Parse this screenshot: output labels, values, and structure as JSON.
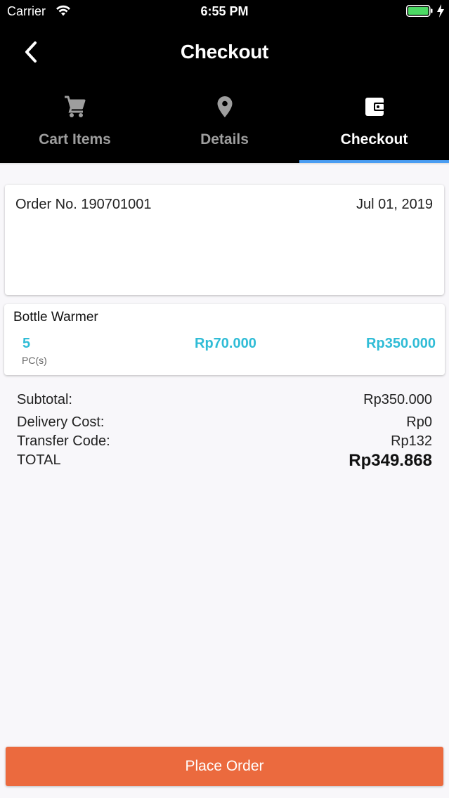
{
  "status_bar": {
    "carrier": "Carrier",
    "time": "6:55 PM",
    "wifi_icon": "wifi-icon",
    "battery_icon": "battery-full-icon",
    "charging_icon": "bolt-icon",
    "battery_color": "#4cd964"
  },
  "nav": {
    "title": "Checkout",
    "back_icon": "chevron-left-icon"
  },
  "tabs": [
    {
      "label": "Cart Items",
      "icon": "cart-icon",
      "active": false
    },
    {
      "label": "Details",
      "icon": "location-pin-icon",
      "active": false
    },
    {
      "label": "Checkout",
      "icon": "wallet-icon",
      "active": true
    }
  ],
  "order": {
    "number": "Order No. 190701001",
    "date": "Jul 01, 2019"
  },
  "items": [
    {
      "name": "Bottle Warmer",
      "quantity": "5",
      "unit": "PC(s)",
      "unit_price": "Rp70.000",
      "line_total": "Rp350.000"
    }
  ],
  "summary": {
    "subtotal_label": "Subtotal:",
    "subtotal_value": "Rp350.000",
    "delivery_label": "Delivery Cost:",
    "delivery_value": "Rp0",
    "transfer_label": "Transfer Code:",
    "transfer_value": "Rp132",
    "total_label": "TOTAL",
    "total_value": "Rp349.868"
  },
  "place_order_label": "Place Order",
  "colors": {
    "accent": "#30bcd6",
    "tab_indicator": "#4a9df2",
    "button": "#eb6a3e"
  }
}
